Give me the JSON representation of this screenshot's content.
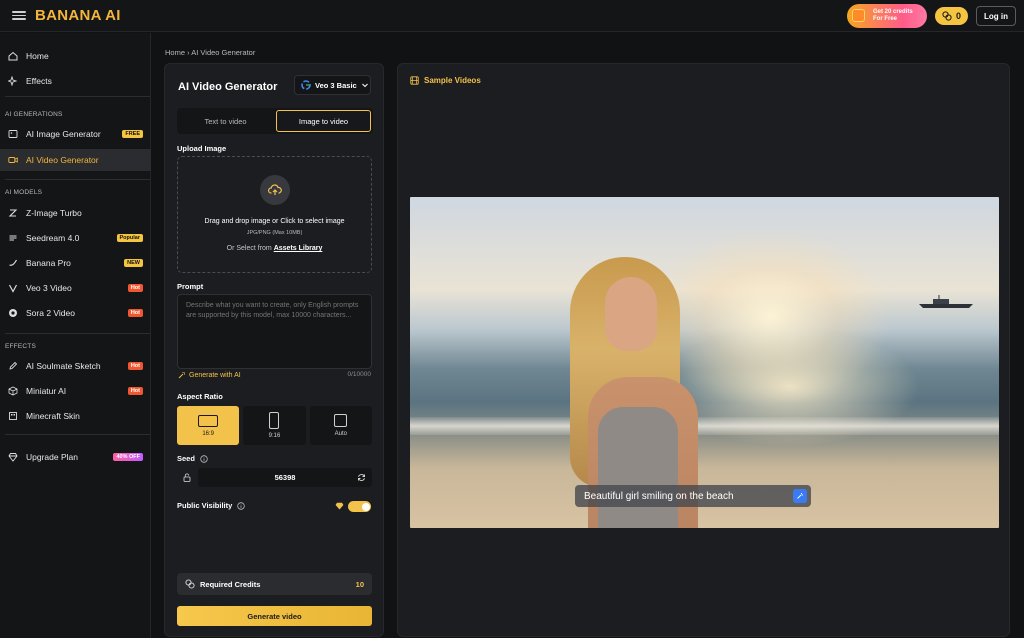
{
  "header": {
    "logo": "BANANA AI",
    "promo_line1": "Get 20 credits",
    "promo_line2": "For Free",
    "credits": "0",
    "login": "Log in"
  },
  "sidebar": {
    "items_top": [
      {
        "label": "Home",
        "icon": "home-icon"
      },
      {
        "label": "Effects",
        "icon": "sparkle-icon"
      }
    ],
    "sections": {
      "ai_generations": "AI GENERATIONS",
      "ai_models": "AI MODELS",
      "effects": "EFFECTS"
    },
    "generations": [
      {
        "label": "AI Image Generator",
        "badge": "FREE"
      },
      {
        "label": "AI Video Generator"
      }
    ],
    "models": [
      {
        "label": "Z-Image Turbo"
      },
      {
        "label": "Seedream 4.0",
        "badge": "Popular"
      },
      {
        "label": "Banana Pro",
        "badge": "NEW"
      },
      {
        "label": "Veo 3 Video",
        "badge": "Hot"
      },
      {
        "label": "Sora 2 Video",
        "badge": "Hot"
      }
    ],
    "effects": [
      {
        "label": "AI Soulmate Sketch",
        "badge": "Hot"
      },
      {
        "label": "Miniatur AI",
        "badge": "Hot"
      },
      {
        "label": "Minecraft Skin"
      }
    ],
    "upgrade": {
      "label": "Upgrade Plan",
      "badge": "40% OFF"
    }
  },
  "breadcrumb": "Home › AI Video Generator",
  "generator": {
    "title": "AI Video Generator",
    "model": "Veo 3 Basic",
    "tabs": [
      "Text to video",
      "Image to video"
    ],
    "active_tab": "Image to video",
    "upload_label": "Upload Image",
    "upload_main": "Drag and drop image or Click to select image",
    "upload_sub": "JPG/PNG (Max 10MB)",
    "upload_lib_prefix": "Or Select from ",
    "upload_lib_link": "Assets Library",
    "prompt_label": "Prompt",
    "prompt_placeholder": "Describe what you want to create, only English prompts are supported by this model, max 10000 characters...",
    "generate_ai": "Generate with AI",
    "char_count": "0/10000",
    "aspect_label": "Aspect Ratio",
    "ratios": [
      {
        "label": "16:9"
      },
      {
        "label": "9:16"
      },
      {
        "label": "Auto"
      }
    ],
    "active_ratio": "16:9",
    "seed_label": "Seed",
    "seed_value": "56398",
    "visibility_label": "Public Visibility",
    "required_credits_label": "Required Credits",
    "required_credits_value": "10",
    "generate_button": "Generate video"
  },
  "samples": {
    "title": "Sample Videos",
    "caption": "Beautiful girl smiling on the beach"
  },
  "colors": {
    "accent": "#f3c24a",
    "background": "#111214",
    "panel": "#1c1d20"
  }
}
